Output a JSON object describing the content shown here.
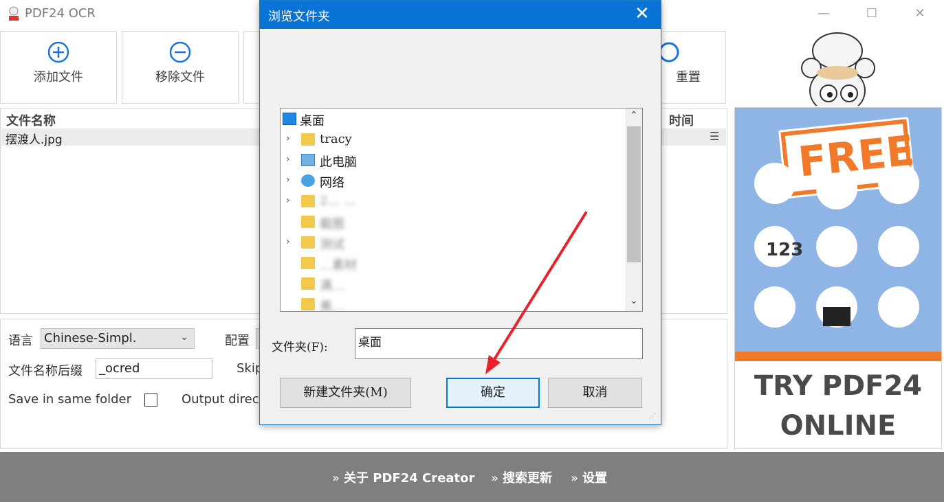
{
  "app": {
    "title": "PDF24 OCR",
    "logo_name": "pdf24-logo"
  },
  "toolbar": {
    "add_label": "添加文件",
    "remove_label": "移除文件",
    "reset_label": "重置",
    "add_icon": "plus-circle-icon",
    "remove_icon": "minus-circle-icon",
    "reset_icon": "reset-icon"
  },
  "file_list": {
    "columns": {
      "name": "文件名称",
      "time": "时间"
    },
    "rows": [
      {
        "name": "摆渡人.jpg"
      }
    ]
  },
  "options": {
    "language_label": "语言",
    "language_value": "Chinese-Simpl.",
    "config_label": "配置",
    "suffix_label": "文件名称后缀",
    "suffix_value": "_ocred",
    "skip_label": "Skip",
    "same_folder_label": "Save in same folder",
    "same_folder_checked": false,
    "output_dir_label": "Output direc"
  },
  "dialog": {
    "title": "浏览文件夹",
    "tree": [
      {
        "label": "桌面",
        "icon": "desktop-icon",
        "expandable": false,
        "selected": true,
        "blurred": false
      },
      {
        "label": "tracy",
        "icon": "user-folder-icon",
        "expandable": true,
        "selected": false,
        "blurred": false
      },
      {
        "label": "此电脑",
        "icon": "computer-icon",
        "expandable": true,
        "selected": false,
        "blurred": false
      },
      {
        "label": "网络",
        "icon": "network-icon",
        "expandable": true,
        "selected": false,
        "blurred": false
      },
      {
        "label": "2… …",
        "icon": "folder-icon",
        "expandable": true,
        "selected": false,
        "blurred": true
      },
      {
        "label": "截图",
        "icon": "folder-icon",
        "expandable": false,
        "selected": false,
        "blurred": true
      },
      {
        "label": "测试",
        "icon": "folder-icon",
        "expandable": true,
        "selected": false,
        "blurred": true
      },
      {
        "label": "…素材",
        "icon": "folder-icon",
        "expandable": false,
        "selected": false,
        "blurred": true
      },
      {
        "label": "满…",
        "icon": "folder-icon",
        "expandable": false,
        "selected": false,
        "blurred": true
      },
      {
        "label": "美…",
        "icon": "folder-icon",
        "expandable": false,
        "selected": false,
        "blurred": true
      }
    ],
    "folder_label": "文件夹(F):",
    "folder_value": "桌面",
    "new_folder_label": "新建文件夹(M)",
    "ok_label": "确定",
    "cancel_label": "取消"
  },
  "ad": {
    "badge": "FREE",
    "line1": "TRY PDF24",
    "line2": "ONLINE",
    "colors": {
      "blue": "#8fb4e6",
      "orange": "#f07a2a"
    }
  },
  "footer": {
    "links": [
      "关于 PDF24 Creator",
      "搜索更新",
      "设置"
    ]
  },
  "annotation": {
    "arrow_color": "#e8212a"
  }
}
